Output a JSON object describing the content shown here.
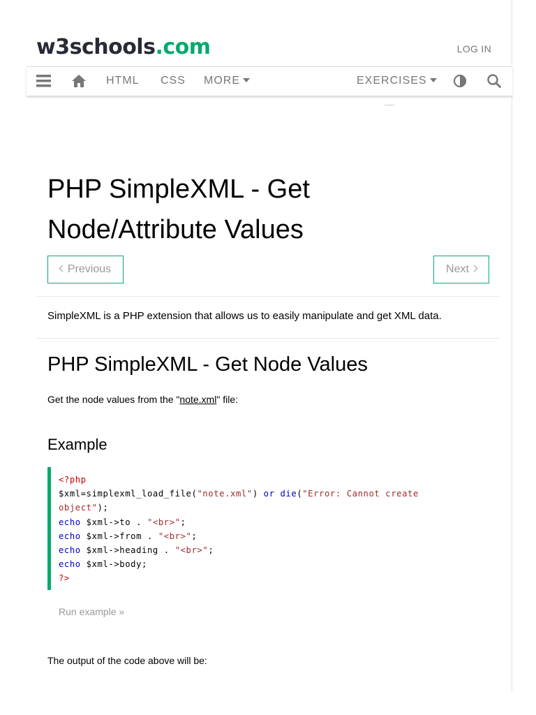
{
  "header": {
    "logo_main": "w3schools",
    "logo_dot": ".com",
    "login": "LOG IN"
  },
  "nav": {
    "menu_icon": "hamburger-menu-icon",
    "home_icon": "home-icon",
    "html": "HTML",
    "css": "CSS",
    "more": "MORE",
    "exercises": "EXERCISES",
    "theme_icon": "contrast-icon",
    "search_icon": "search-icon"
  },
  "page": {
    "title_line1": "PHP SimpleXML - Get",
    "title_line2": "Node/Attribute Values",
    "prev": "Previous",
    "next": "Next",
    "intro": "SimpleXML is a PHP extension that allows us to easily manipulate and get XML data.",
    "h2": "PHP SimpleXML - Get Node Values",
    "node_text_pre": "Get the node values from the \"",
    "node_link": "note.xml",
    "node_text_post": "\" file:",
    "example_heading": "Example",
    "code": {
      "open_tag": "<?php",
      "l2_a": "$xml=simplexml_load_file(",
      "l2_str1": "\"note.xml\"",
      "l2_or": " or ",
      "l2_die": "die",
      "l2_paren": "(",
      "l2_str2": "\"Error: Cannot create",
      "l3_str": "object\"",
      "l3_end": ");",
      "echo": "echo",
      "l4": " $xml->to . ",
      "l5": " $xml->from . ",
      "l6": " $xml->heading . ",
      "l7": " $xml->body;",
      "br": "\"<br>\"",
      "semi": ";",
      "close_tag": "?>"
    },
    "run_example": "Run example »",
    "output_text": "The output of the code above will be:"
  },
  "colors": {
    "accent": "#04AA6D",
    "text_muted": "#777777",
    "code_tag": "#cc0000",
    "code_string": "#a52a2a",
    "code_keyword": "#0000cd"
  }
}
